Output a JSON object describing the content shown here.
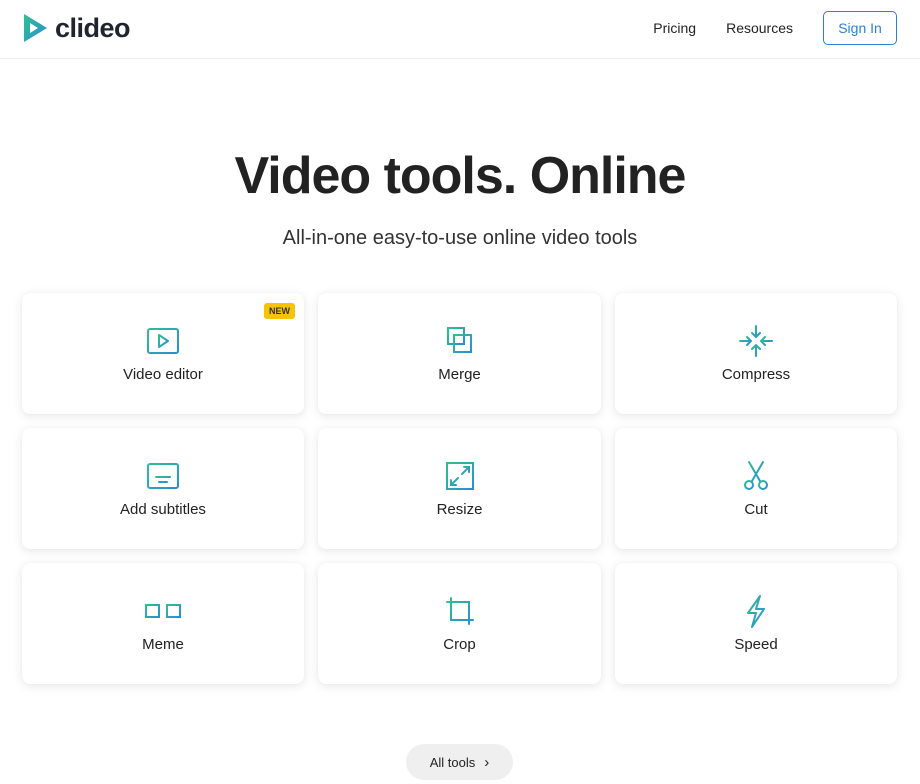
{
  "header": {
    "logo_text": "clideo",
    "nav": [
      "Pricing",
      "Resources"
    ],
    "signin_label": "Sign In"
  },
  "hero": {
    "title": "Video tools. Online",
    "subtitle": "All-in-one easy-to-use online video tools"
  },
  "tools": [
    {
      "label": "Video editor",
      "icon": "play-icon",
      "badge": "NEW"
    },
    {
      "label": "Merge",
      "icon": "merge-icon"
    },
    {
      "label": "Compress",
      "icon": "compress-icon"
    },
    {
      "label": "Add subtitles",
      "icon": "subtitles-icon"
    },
    {
      "label": "Resize",
      "icon": "resize-icon"
    },
    {
      "label": "Cut",
      "icon": "scissors-icon"
    },
    {
      "label": "Meme",
      "icon": "glasses-icon"
    },
    {
      "label": "Crop",
      "icon": "crop-icon"
    },
    {
      "label": "Speed",
      "icon": "lightning-icon"
    }
  ],
  "all_tools_label": "All tools",
  "colors": {
    "accent": "#2f7fd6",
    "icon_gradient_start": "#2fbf8f",
    "icon_gradient_end": "#2a8ed6",
    "badge": "#f6c400"
  }
}
